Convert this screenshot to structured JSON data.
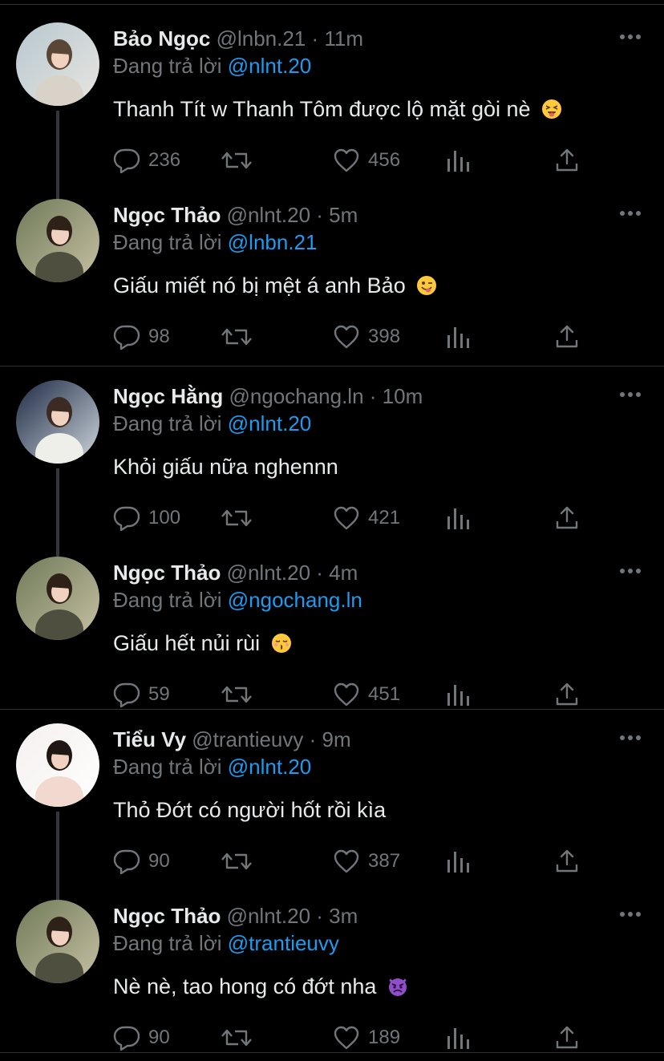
{
  "colors": {
    "background": "#000000",
    "text": "#e7e9ea",
    "muted": "#71767b",
    "link": "#1d9bf0",
    "divider": "#2f3336"
  },
  "groups": [
    {
      "tweets": [
        {
          "name": "Bảo Ngọc",
          "handle": "@lnbn.21",
          "dot": "·",
          "time": "11m",
          "reply_prefix": "Đang trả lời",
          "reply_to": "@nlnt.20",
          "text": "Thanh Tít w Thanh Tôm được lộ mặt gòi nè",
          "emoji": "squinting-tongue",
          "replies": "236",
          "likes": "456"
        },
        {
          "name": "Ngọc Thảo",
          "handle": "@nlnt.20",
          "dot": "·",
          "time": "5m",
          "reply_prefix": "Đang trả lời",
          "reply_to": "@lnbn.21",
          "text": "Giấu miết nó bị mệt á anh Bảo",
          "emoji": "winking-tongue",
          "replies": "98",
          "likes": "398"
        }
      ]
    },
    {
      "tweets": [
        {
          "name": "Ngọc Hằng",
          "handle": "@ngochang.ln",
          "dot": "·",
          "time": "10m",
          "reply_prefix": "Đang trả lời",
          "reply_to": "@nlnt.20",
          "text": "Khỏi giấu nữa nghennn",
          "emoji": "",
          "replies": "100",
          "likes": "421"
        },
        {
          "name": "Ngọc Thảo",
          "handle": "@nlnt.20",
          "dot": "·",
          "time": "4m",
          "reply_prefix": "Đang trả lời",
          "reply_to": "@ngochang.ln",
          "text": "Giấu hết nủi rùi",
          "emoji": "kissing-closed-eyes",
          "replies": "59",
          "likes": "451"
        }
      ]
    },
    {
      "tweets": [
        {
          "name": "Tiểu Vy",
          "handle": "@trantieuvy",
          "dot": "·",
          "time": "9m",
          "reply_prefix": "Đang trả lời",
          "reply_to": "@nlnt.20",
          "text": "Thỏ Đớt có người hốt rồi kìa",
          "emoji": "",
          "replies": "90",
          "likes": "387"
        },
        {
          "name": "Ngọc Thảo",
          "handle": "@nlnt.20",
          "dot": "·",
          "time": "3m",
          "reply_prefix": "Đang trả lời",
          "reply_to": "@trantieuvy",
          "text": "Nè nè, tao hong có đớt nha",
          "emoji": "angry-devil",
          "replies": "90",
          "likes": "189"
        }
      ]
    }
  ],
  "icons": {
    "reply": "speech-bubble-icon",
    "retweet": "retweet-icon",
    "like": "heart-icon",
    "stats": "bar-chart-icon",
    "share": "share-icon",
    "more": "more-dots-icon"
  }
}
